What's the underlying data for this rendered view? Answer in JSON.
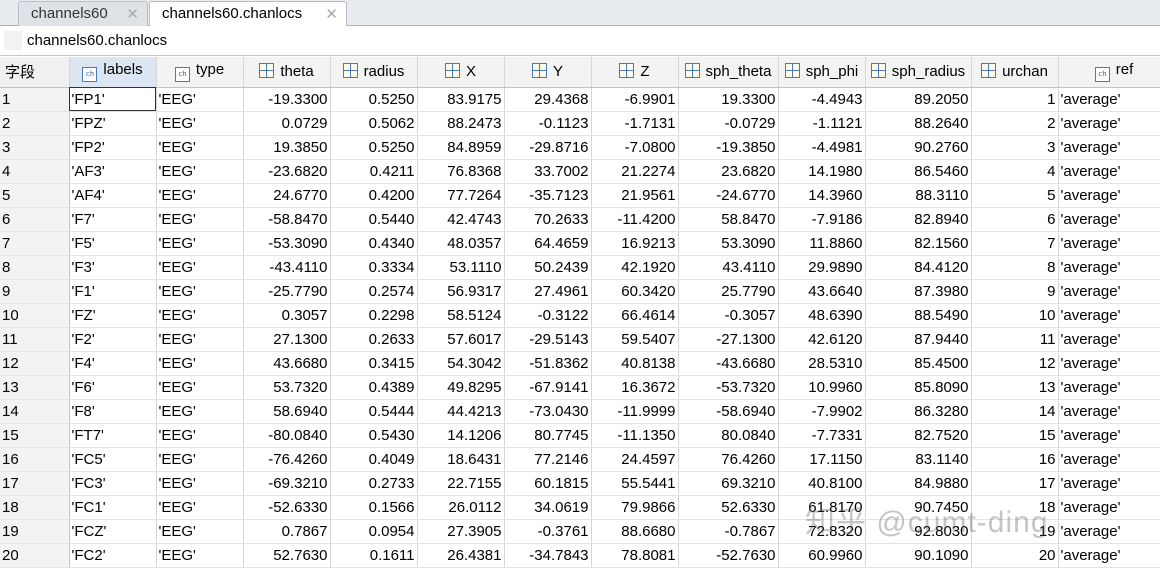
{
  "tabs": [
    {
      "label": "channels60"
    },
    {
      "label": "channels60.chanlocs"
    }
  ],
  "path": "channels60.chanlocs",
  "corner_label": "字段",
  "columns": [
    {
      "label": "labels",
      "icon": "char-icon"
    },
    {
      "label": "type",
      "icon": "char-icon"
    },
    {
      "label": "theta",
      "icon": "numeric-icon"
    },
    {
      "label": "radius",
      "icon": "numeric-icon"
    },
    {
      "label": "X",
      "icon": "numeric-icon"
    },
    {
      "label": "Y",
      "icon": "numeric-icon"
    },
    {
      "label": "Z",
      "icon": "numeric-icon"
    },
    {
      "label": "sph_theta",
      "icon": "numeric-icon"
    },
    {
      "label": "sph_phi",
      "icon": "numeric-icon"
    },
    {
      "label": "sph_radius",
      "icon": "numeric-icon"
    },
    {
      "label": "urchan",
      "icon": "numeric-icon"
    },
    {
      "label": "ref",
      "icon": "char-icon"
    }
  ],
  "rows": [
    [
      "1",
      "'FP1'",
      "'EEG'",
      "-19.3300",
      "0.5250",
      "83.9175",
      "29.4368",
      "-6.9901",
      "19.3300",
      "-4.4943",
      "89.2050",
      "1",
      "'average'"
    ],
    [
      "2",
      "'FPZ'",
      "'EEG'",
      "0.0729",
      "0.5062",
      "88.2473",
      "-0.1123",
      "-1.7131",
      "-0.0729",
      "-1.1121",
      "88.2640",
      "2",
      "'average'"
    ],
    [
      "3",
      "'FP2'",
      "'EEG'",
      "19.3850",
      "0.5250",
      "84.8959",
      "-29.8716",
      "-7.0800",
      "-19.3850",
      "-4.4981",
      "90.2760",
      "3",
      "'average'"
    ],
    [
      "4",
      "'AF3'",
      "'EEG'",
      "-23.6820",
      "0.4211",
      "76.8368",
      "33.7002",
      "21.2274",
      "23.6820",
      "14.1980",
      "86.5460",
      "4",
      "'average'"
    ],
    [
      "5",
      "'AF4'",
      "'EEG'",
      "24.6770",
      "0.4200",
      "77.7264",
      "-35.7123",
      "21.9561",
      "-24.6770",
      "14.3960",
      "88.3110",
      "5",
      "'average'"
    ],
    [
      "6",
      "'F7'",
      "'EEG'",
      "-58.8470",
      "0.5440",
      "42.4743",
      "70.2633",
      "-11.4200",
      "58.8470",
      "-7.9186",
      "82.8940",
      "6",
      "'average'"
    ],
    [
      "7",
      "'F5'",
      "'EEG'",
      "-53.3090",
      "0.4340",
      "48.0357",
      "64.4659",
      "16.9213",
      "53.3090",
      "11.8860",
      "82.1560",
      "7",
      "'average'"
    ],
    [
      "8",
      "'F3'",
      "'EEG'",
      "-43.4110",
      "0.3334",
      "53.1110",
      "50.2439",
      "42.1920",
      "43.4110",
      "29.9890",
      "84.4120",
      "8",
      "'average'"
    ],
    [
      "9",
      "'F1'",
      "'EEG'",
      "-25.7790",
      "0.2574",
      "56.9317",
      "27.4961",
      "60.3420",
      "25.7790",
      "43.6640",
      "87.3980",
      "9",
      "'average'"
    ],
    [
      "10",
      "'FZ'",
      "'EEG'",
      "0.3057",
      "0.2298",
      "58.5124",
      "-0.3122",
      "66.4614",
      "-0.3057",
      "48.6390",
      "88.5490",
      "10",
      "'average'"
    ],
    [
      "11",
      "'F2'",
      "'EEG'",
      "27.1300",
      "0.2633",
      "57.6017",
      "-29.5143",
      "59.5407",
      "-27.1300",
      "42.6120",
      "87.9440",
      "11",
      "'average'"
    ],
    [
      "12",
      "'F4'",
      "'EEG'",
      "43.6680",
      "0.3415",
      "54.3042",
      "-51.8362",
      "40.8138",
      "-43.6680",
      "28.5310",
      "85.4500",
      "12",
      "'average'"
    ],
    [
      "13",
      "'F6'",
      "'EEG'",
      "53.7320",
      "0.4389",
      "49.8295",
      "-67.9141",
      "16.3672",
      "-53.7320",
      "10.9960",
      "85.8090",
      "13",
      "'average'"
    ],
    [
      "14",
      "'F8'",
      "'EEG'",
      "58.6940",
      "0.5444",
      "44.4213",
      "-73.0430",
      "-11.9999",
      "-58.6940",
      "-7.9902",
      "86.3280",
      "14",
      "'average'"
    ],
    [
      "15",
      "'FT7'",
      "'EEG'",
      "-80.0840",
      "0.5430",
      "14.1206",
      "80.7745",
      "-11.1350",
      "80.0840",
      "-7.7331",
      "82.7520",
      "15",
      "'average'"
    ],
    [
      "16",
      "'FC5'",
      "'EEG'",
      "-76.4260",
      "0.4049",
      "18.6431",
      "77.2146",
      "24.4597",
      "76.4260",
      "17.1150",
      "83.1140",
      "16",
      "'average'"
    ],
    [
      "17",
      "'FC3'",
      "'EEG'",
      "-69.3210",
      "0.2733",
      "22.7155",
      "60.1815",
      "55.5441",
      "69.3210",
      "40.8100",
      "84.9880",
      "17",
      "'average'"
    ],
    [
      "18",
      "'FC1'",
      "'EEG'",
      "-52.6330",
      "0.1566",
      "26.0112",
      "34.0619",
      "79.9866",
      "52.6330",
      "61.8170",
      "90.7450",
      "18",
      "'average'"
    ],
    [
      "19",
      "'FCZ'",
      "'EEG'",
      "0.7867",
      "0.0954",
      "27.3905",
      "-0.3761",
      "88.6680",
      "-0.7867",
      "72.8320",
      "92.8030",
      "19",
      "'average'"
    ],
    [
      "20",
      "'FC2'",
      "'EEG'",
      "52.7630",
      "0.1611",
      "26.4381",
      "-34.7843",
      "78.8081",
      "-52.7630",
      "60.9960",
      "90.1090",
      "20",
      "'average'"
    ]
  ],
  "watermark": "知乎 @cumt-ding"
}
